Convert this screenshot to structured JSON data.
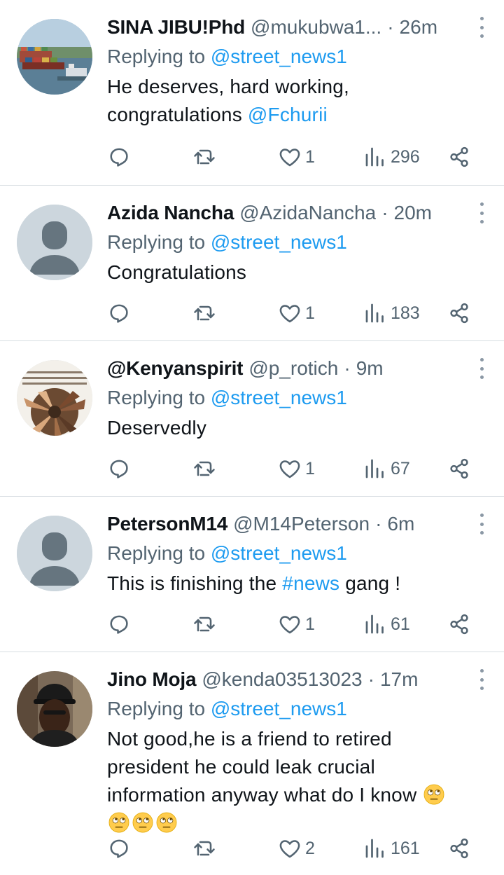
{
  "tweets": [
    {
      "name": "SINA JIBU!Phd",
      "handle": "@mukubwa1...",
      "separator": "·",
      "time": "26m",
      "replying_prefix": "Replying to",
      "replying_to": "@street_news1",
      "text_before": "He deserves, hard working, congratulations",
      "text_link": "@Fchurii",
      "text_after": "",
      "likes": "1",
      "views": "296",
      "avatar": "ship-port-photo"
    },
    {
      "name": "Azida Nancha",
      "handle": "@AzidaNancha",
      "separator": "·",
      "time": "20m",
      "replying_prefix": "Replying to",
      "replying_to": "@street_news1",
      "text_before": "Congratulations",
      "text_link": "",
      "text_after": "",
      "likes": "1",
      "views": "183",
      "avatar": "default-avatar"
    },
    {
      "name": "@Kenyanspirit",
      "handle": "@p_rotich",
      "separator": "·",
      "time": "9m",
      "replying_prefix": "Replying to",
      "replying_to": "@street_news1",
      "text_before": "Deservedly",
      "text_link": "",
      "text_after": "",
      "likes": "1",
      "views": "67",
      "avatar": "teamwork-hands-photo"
    },
    {
      "name": "PetersonM14",
      "handle": "@M14Peterson",
      "separator": "·",
      "time": "6m",
      "replying_prefix": "Replying to",
      "replying_to": "@street_news1",
      "text_before": "This is finishing the",
      "text_link": "#news",
      "text_after": "gang !",
      "likes": "1",
      "views": "61",
      "avatar": "default-avatar"
    },
    {
      "name": "Jino Moja",
      "handle": "@kenda03513023",
      "separator": "·",
      "time": "17m",
      "replying_prefix": "Replying to",
      "replying_to": "@street_news1",
      "text_before": "Not good,he is a friend to retired president he could leak crucial information anyway what do I know",
      "text_link": "",
      "text_after": "",
      "emoji": "face-with-rolling-eyes",
      "emoji_count": 4,
      "likes": "2",
      "views": "161",
      "avatar": "man-with-cap-photo"
    }
  ],
  "icons": {
    "reply": "reply-bubble-icon",
    "retweet": "retweet-icon",
    "like": "heart-icon",
    "views": "views-bars-icon",
    "share": "share-icon",
    "more": "more-vertical-icon"
  },
  "colors": {
    "link": "#1d9bf0",
    "secondary_text": "#536471",
    "primary_text": "#0f1419",
    "divider": "#d7dde2"
  }
}
